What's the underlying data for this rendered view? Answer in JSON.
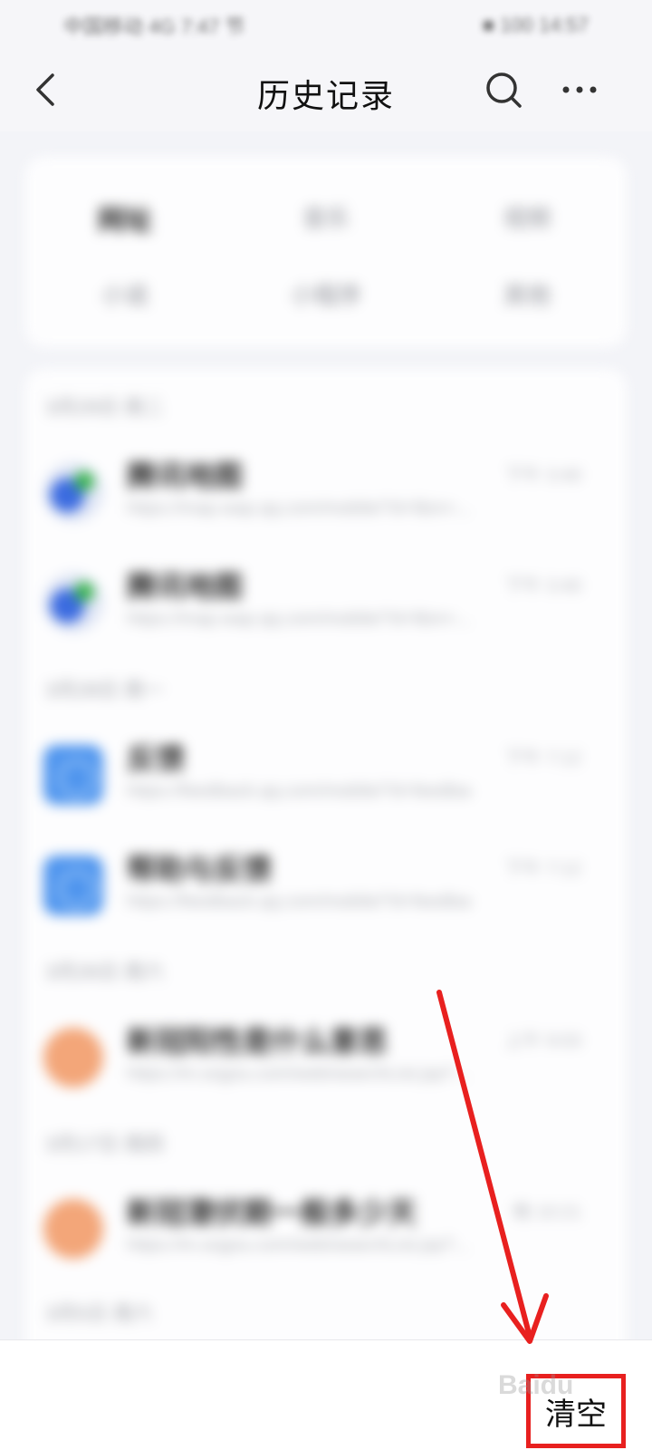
{
  "status_bar": {
    "left_text": "中国移动 4G 7:47 节",
    "right_text": "■ 100 14:57"
  },
  "header": {
    "title": "历史记录"
  },
  "filters": {
    "row1": [
      "网址",
      "音乐",
      "视频"
    ],
    "row2": [
      "小说",
      "小程序",
      "其他"
    ]
  },
  "groups": [
    {
      "label": "3月29日 周二",
      "items": [
        {
          "icon": "map-icon",
          "title": "腾讯地图",
          "url": "https://map.wap.qq.com/mobile/?d=f&m=...",
          "time": "下午 3:40"
        },
        {
          "icon": "map-icon",
          "title": "腾讯地图",
          "url": "https://map.wap.qq.com/mobile/?d=f&m=...",
          "time": "下午 3:40"
        }
      ]
    },
    {
      "label": "3月28日 周一",
      "items": [
        {
          "icon": "globe-icon",
          "title": "反馈",
          "url": "https://feedback.qq.com/mobile/?d=feedback...",
          "time": "下午 7:12"
        },
        {
          "icon": "globe-icon",
          "title": "帮助与反馈",
          "url": "https://feedback.qq.com/mobile/?d=feedback",
          "time": "下午 7:12"
        }
      ]
    },
    {
      "label": "3月26日 周六",
      "items": [
        {
          "icon": "sogou-icon",
          "title": "新冠阳性是什么意思",
          "url": "https://m.sogou.com/web/searchList.jsp?...",
          "time": "上午 9:03"
        }
      ]
    },
    {
      "label": "3月17日 周四",
      "items": [
        {
          "icon": "sogou-icon",
          "title": "新冠潜伏期一般多少天",
          "url": "https://m.sogou.com/web/searchList.jsp?...",
          "time": "晚 10:21"
        }
      ]
    },
    {
      "label": "3月5日 周六",
      "items": []
    }
  ],
  "bottom_bar": {
    "clear_label": "清空"
  },
  "watermark": "Baidu",
  "colors": {
    "highlight": "#e8201f",
    "accent_blue": "#4f95ee"
  }
}
